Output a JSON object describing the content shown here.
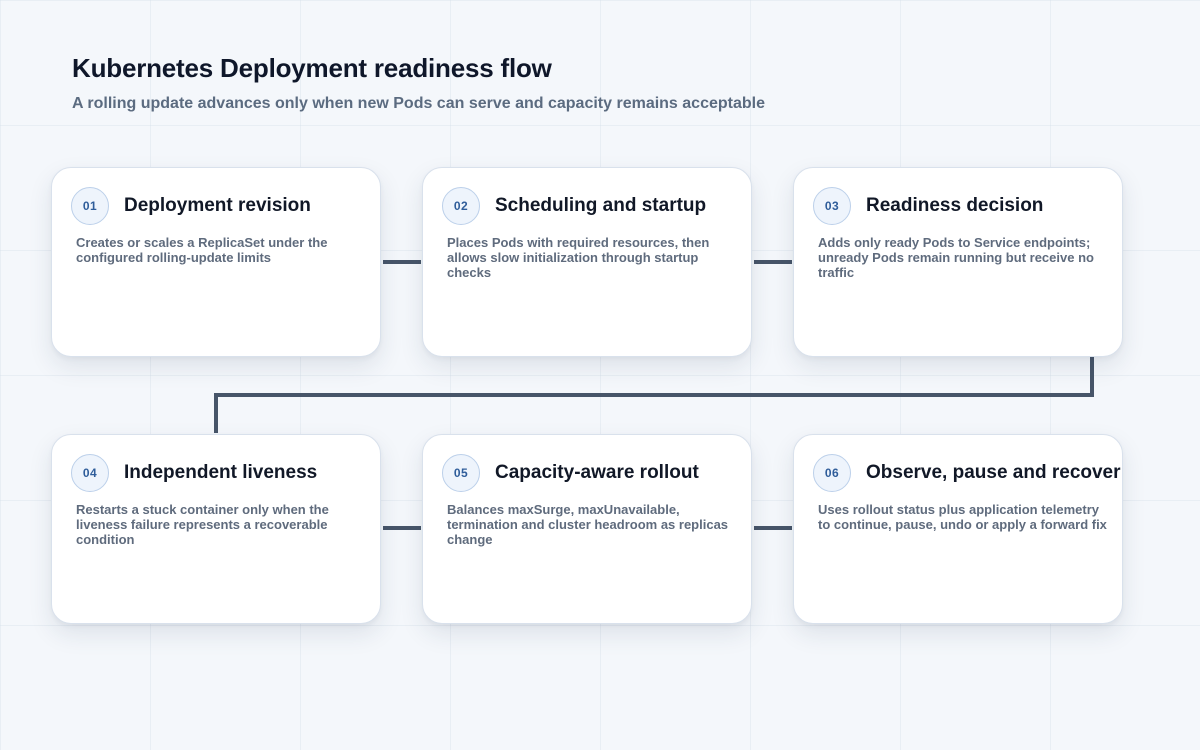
{
  "header": {
    "title": "Kubernetes Deployment readiness flow",
    "subtitle": "A rolling update advances only when new Pods can serve and capacity remains acceptable"
  },
  "colors": {
    "connector": "#475569",
    "badge_text": "#2f5d9a",
    "badge_border": "#bcd0ea",
    "card_background": "#ffffff"
  },
  "steps": [
    {
      "number": "01",
      "title": "Deployment revision",
      "description": "Creates or scales a ReplicaSet under the configured rolling-update limits"
    },
    {
      "number": "02",
      "title": "Scheduling and startup",
      "description": "Places Pods with required resources, then allows slow initialization through startup checks"
    },
    {
      "number": "03",
      "title": "Readiness decision",
      "description": "Adds only ready Pods to Service endpoints; unready Pods remain running but receive no traffic"
    },
    {
      "number": "04",
      "title": "Independent liveness",
      "description": "Restarts a stuck container only when the liveness failure represents a recoverable condition"
    },
    {
      "number": "05",
      "title": "Capacity-aware rollout",
      "description": "Balances maxSurge, maxUnavailable, termination and cluster headroom as replicas change"
    },
    {
      "number": "06",
      "title": "Observe, pause and recover",
      "description": "Uses rollout status plus application telemetry to continue, pause, undo or apply a forward fix"
    }
  ]
}
